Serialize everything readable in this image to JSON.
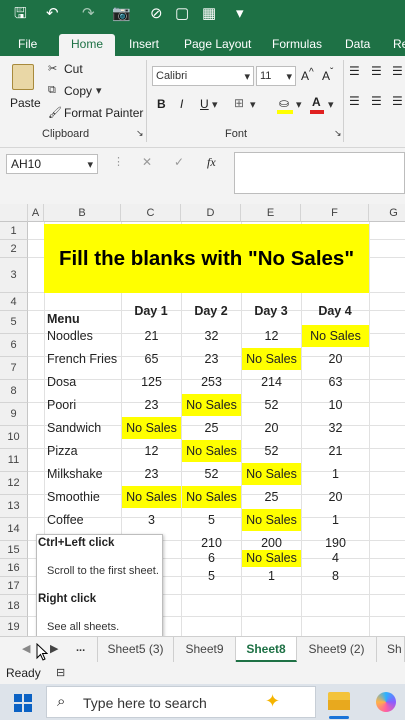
{
  "qat": {
    "save": "🖫",
    "undo": "↶",
    "redo": "↷",
    "camera": "📷",
    "more": "⋯"
  },
  "tabs": [
    "File",
    "Home",
    "Insert",
    "Page Layout",
    "Formulas",
    "Data",
    "Re"
  ],
  "ribbon": {
    "paste": "Paste",
    "cut": "Cut",
    "copy": "Copy",
    "format_painter": "Format Painter",
    "clipboard": "Clipboard",
    "font_name": "Calibri",
    "font_size": "11",
    "font_group": "Font",
    "bold": "B",
    "italic": "I",
    "underline": "U"
  },
  "formula_bar": {
    "name_box": "AH10",
    "fx": "fx"
  },
  "columns": [
    "A",
    "B",
    "C",
    "D",
    "E",
    "F",
    "G"
  ],
  "rows": [
    "1",
    "2",
    "3",
    "4",
    "5",
    "6",
    "7",
    "8",
    "9",
    "10",
    "11",
    "12",
    "13",
    "14",
    "15",
    "16",
    "17",
    "18",
    "19"
  ],
  "sheet": {
    "title": "Fill the blanks with \"No Sales\"",
    "header": {
      "menu": "Menu",
      "days": [
        "Day 1",
        "Day 2",
        "Day 3",
        "Day 4"
      ]
    },
    "items": [
      {
        "name": "Noodles",
        "d": [
          "21",
          "32",
          "12",
          "No Sales"
        ]
      },
      {
        "name": "French Fries",
        "d": [
          "65",
          "23",
          "No Sales",
          "20"
        ]
      },
      {
        "name": "Dosa",
        "d": [
          "125",
          "253",
          "214",
          "63"
        ]
      },
      {
        "name": "Poori",
        "d": [
          "23",
          "No Sales",
          "52",
          "10"
        ]
      },
      {
        "name": "Sandwich",
        "d": [
          "No Sales",
          "25",
          "20",
          "32"
        ]
      },
      {
        "name": "Pizza",
        "d": [
          "12",
          "No Sales",
          "52",
          "21"
        ]
      },
      {
        "name": "Milkshake",
        "d": [
          "23",
          "52",
          "No Sales",
          "1"
        ]
      },
      {
        "name": "Smoothie",
        "d": [
          "No Sales",
          "No Sales",
          "25",
          "20"
        ]
      },
      {
        "name": "Coffee",
        "d": [
          "3",
          "5",
          "No Sales",
          "1"
        ]
      },
      {
        "name": "",
        "d": [
          "",
          "210",
          "200",
          "190"
        ]
      },
      {
        "name": "",
        "d": [
          "",
          "6",
          "No Sales",
          "4"
        ]
      },
      {
        "name": "",
        "d": [
          "",
          "5",
          "1",
          "8"
        ]
      }
    ]
  },
  "tooltip": {
    "h1": "Ctrl+Left click",
    "t1": "Scroll to the first sheet.",
    "h2": "Right click",
    "t2": "See all sheets."
  },
  "sheet_tabs": {
    "ellipsis": "...",
    "tabs": [
      "Sheet5 (3)",
      "Sheet9",
      "Sheet8",
      "Sheet9 (2)",
      "Sh"
    ],
    "active": "Sheet8"
  },
  "status": {
    "ready": "Ready"
  },
  "taskbar": {
    "search_placeholder": "Type here to search"
  },
  "colors": {
    "excel_green": "#1e7145",
    "highlight": "#ffff00"
  }
}
